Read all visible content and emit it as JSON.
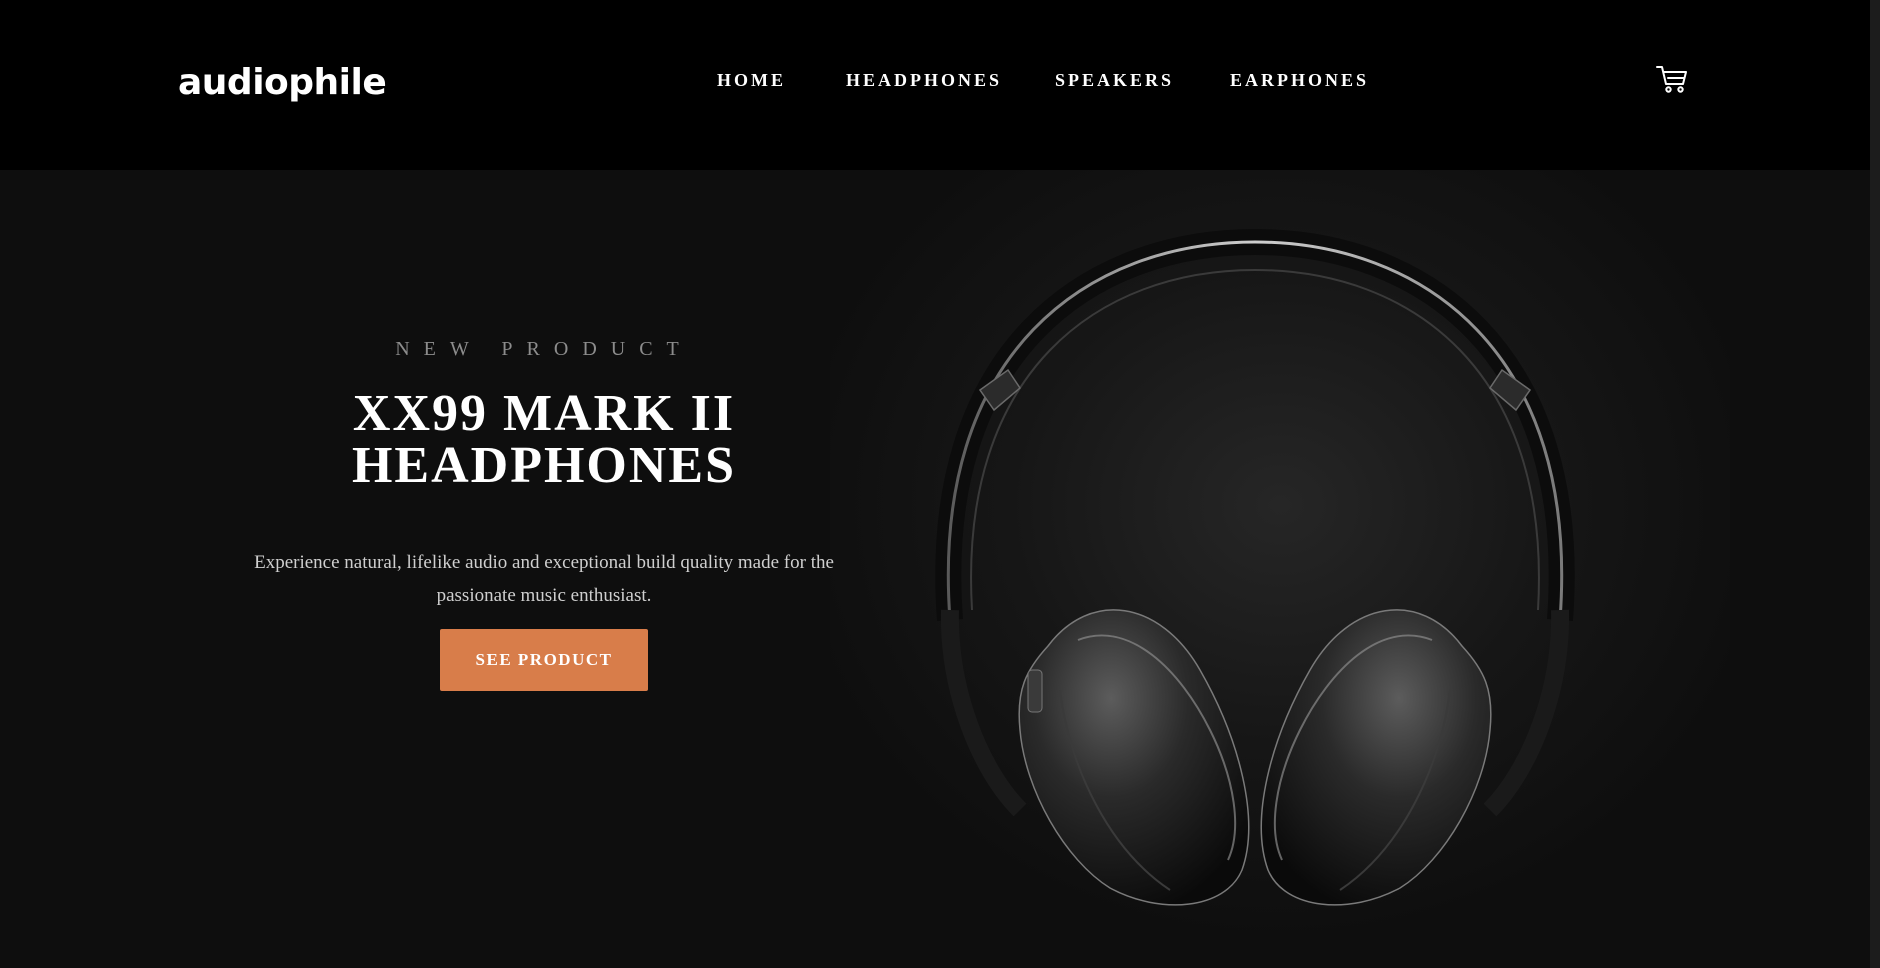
{
  "header": {
    "logo": "audiophile",
    "nav": [
      "HOME",
      "HEADPHONES",
      "SPEAKERS",
      "EARPHONES"
    ],
    "cart_icon": "cart-icon"
  },
  "hero": {
    "eyebrow": "NEW PRODUCT",
    "title_line1": "XX99 MARK II",
    "title_line2": "HEADPHONES",
    "description": "Experience natural, lifelike audio and exceptional build quality made for the passionate music enthusiast.",
    "cta_label": "SEE PRODUCT",
    "image_icon": "headphones-image"
  },
  "colors": {
    "header_bg": "#000000",
    "hero_bg": "#0e0e0e",
    "accent": "#d87d4a",
    "text_primary": "#ffffff",
    "text_muted": "#8c8c8c"
  }
}
